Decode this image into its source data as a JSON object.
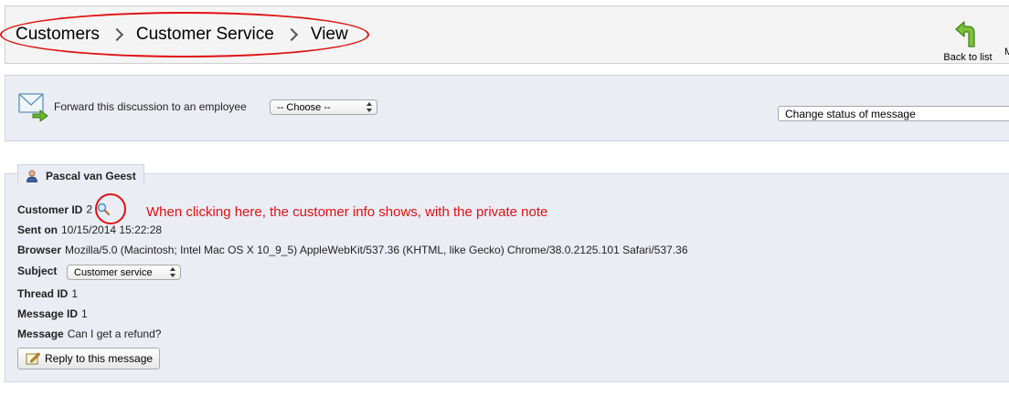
{
  "breadcrumb": [
    "Customers",
    "Customer Service",
    "View"
  ],
  "toolbar": {
    "back_label": "Back to list",
    "more_label": "M"
  },
  "forward": {
    "label": "Forward this discussion to an employee",
    "choose_value": "-- Choose --"
  },
  "status": {
    "selected": "Change status of message"
  },
  "message": {
    "author": "Pascal van Geest",
    "customer_id_label": "Customer ID",
    "customer_id": "2",
    "sent_on_label": "Sent on",
    "sent_on": "10/15/2014 15:22:28",
    "browser_label": "Browser",
    "browser": "Mozilla/5.0 (Macintosh; Intel Mac OS X 10_9_5) AppleWebKit/537.36 (KHTML, like Gecko) Chrome/38.0.2125.101 Safari/537.36",
    "subject_label": "Subject",
    "subject": "Customer service",
    "thread_id_label": "Thread ID",
    "thread_id": "1",
    "message_id_label": "Message ID",
    "message_id": "1",
    "message_label": "Message",
    "message": "Can I get a refund?",
    "reply_label": "Reply to this message"
  },
  "annotation": {
    "text": "When clicking here, the customer info shows, with the private note",
    "color": "#e01010"
  },
  "colors": {
    "panel_bg": "#ebedf5",
    "header_bg": "#f4f4f4",
    "accent_green": "#6cb52d"
  }
}
